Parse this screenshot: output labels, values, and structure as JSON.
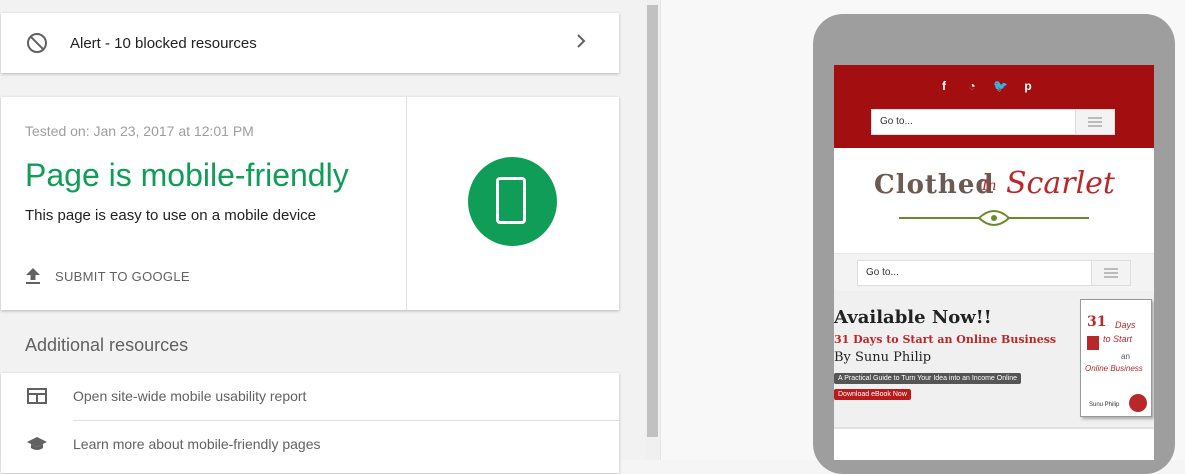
{
  "alert": {
    "text": "Alert - 10 blocked resources",
    "icon": "blocked-icon"
  },
  "result": {
    "tested_on": "Tested on: Jan 23, 2017 at 12:01 PM",
    "verdict": "Page is mobile-friendly",
    "subtext": "This page is easy to use on a mobile device",
    "submit_label": "SUBMIT TO GOOGLE",
    "accent_color": "#0f9d58"
  },
  "additional": {
    "title": "Additional resources",
    "items": [
      {
        "label": "Open site-wide mobile usability report",
        "icon": "report-icon"
      },
      {
        "label": "Learn more about mobile-friendly pages",
        "icon": "school-icon"
      }
    ]
  },
  "preview": {
    "social": [
      "f",
      ")",
      "t",
      "p"
    ],
    "goto_top": "Go to...",
    "goto_nav": "Go to...",
    "logo_part1": "Clothed",
    "logo_part2": "In",
    "logo_part3": "Scarlet",
    "banner_heading": "Available Now!!",
    "banner_title": "31 Days to Start an Online Business",
    "banner_author": "By Sunu Philip",
    "banner_tagline": "A Practical Guide to Turn Your Idea into an Income Online",
    "banner_button": "Download eBook Now",
    "book_number": "31",
    "book_days": "Days",
    "book_tostart": "to Start",
    "book_an": "an",
    "book_online": "Online Business",
    "book_author": "Sunu Philip",
    "brand_color": "#a30f10"
  }
}
